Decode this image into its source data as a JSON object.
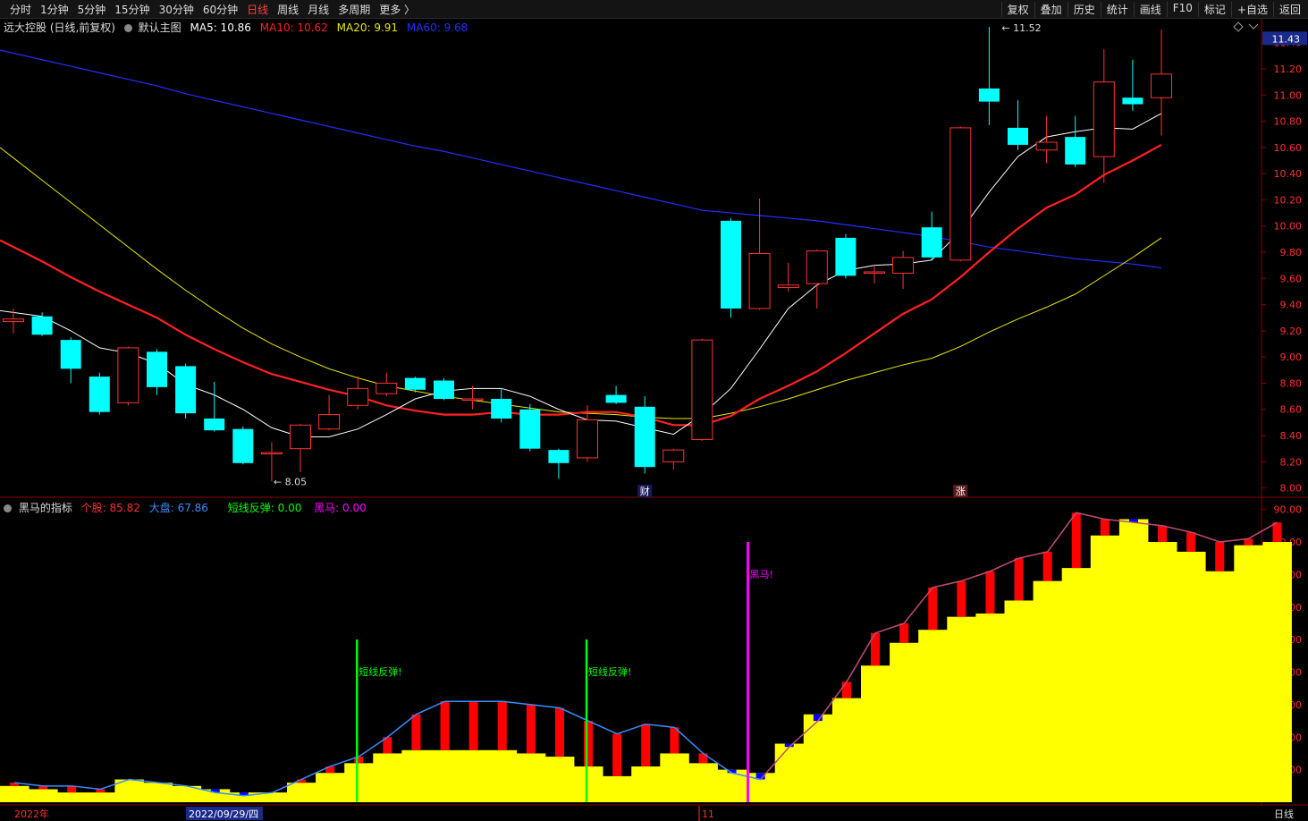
{
  "toolbar": {
    "periods": [
      "分时",
      "1分钟",
      "5分钟",
      "15分钟",
      "30分钟",
      "60分钟",
      "日线",
      "周线",
      "月线",
      "多周期",
      "更多 〉"
    ],
    "active_period": "日线",
    "tools": [
      "复权",
      "叠加",
      "历史",
      "统计",
      "画线",
      "F10",
      "标记",
      "+自选",
      "返回"
    ]
  },
  "main_header": {
    "stock": "远大控股 (日线,前复权)",
    "template": "默认主图",
    "ma5_label": "MA5: 10.86",
    "ma10_label": "MA10: 10.62",
    "ma20_label": "MA20: 9.91",
    "ma60_label": "MA60: 9.68"
  },
  "sub_header": {
    "indicator": "黑马的指标",
    "stock_label": "个股: 85.82",
    "market_label": "大盘: 67.86",
    "rebound_label": "短线反弹: 0.00",
    "horse_label": "黑马: 0.00"
  },
  "colors": {
    "up": "#ff3232",
    "down": "#00ffff",
    "ma5": "#ffffff",
    "ma10": "#ff2020",
    "ma20": "#e8e800",
    "ma60": "#2030ff",
    "vol_yellow": "#ffff00",
    "bar_red": "#ff0000",
    "bar_blue": "#0000ff",
    "market_line": "#3a8cff",
    "signal_green": "#00ff00",
    "signal_magenta": "#ff00ff"
  },
  "chart_data": [
    {
      "type": "candlestick",
      "title": "远大控股 (日线,前复权)",
      "y_ticks": [
        "11.40",
        "11.20",
        "11.00",
        "10.80",
        "10.60",
        "10.40",
        "10.20",
        "10.00",
        "9.80",
        "9.60",
        "9.40",
        "9.20",
        "9.00",
        "8.80",
        "8.60",
        "8.40",
        "8.20",
        "8.00"
      ],
      "current_price": "11.43",
      "ylim": [
        7.97,
        11.48
      ],
      "high_marker": "11.52",
      "low_marker": "8.05",
      "event_markers": [
        "财",
        "涨"
      ],
      "candles": [
        {
          "o": 9.27,
          "c": 9.29,
          "h": 9.37,
          "l": 9.18
        },
        {
          "o": 9.31,
          "c": 9.17,
          "h": 9.34,
          "l": 9.16
        },
        {
          "o": 9.13,
          "c": 8.91,
          "h": 9.15,
          "l": 8.8
        },
        {
          "o": 8.85,
          "c": 8.58,
          "h": 8.88,
          "l": 8.56
        },
        {
          "o": 8.65,
          "c": 9.07,
          "h": 9.08,
          "l": 8.63
        },
        {
          "o": 9.04,
          "c": 8.77,
          "h": 9.06,
          "l": 8.71
        },
        {
          "o": 8.93,
          "c": 8.57,
          "h": 8.95,
          "l": 8.53
        },
        {
          "o": 8.53,
          "c": 8.44,
          "h": 8.81,
          "l": 8.43
        },
        {
          "o": 8.45,
          "c": 8.19,
          "h": 8.47,
          "l": 8.18
        },
        {
          "o": 8.27,
          "c": 8.27,
          "h": 8.35,
          "l": 8.05
        },
        {
          "o": 8.3,
          "c": 8.48,
          "h": 8.49,
          "l": 8.12
        },
        {
          "o": 8.45,
          "c": 8.56,
          "h": 8.71,
          "l": 8.44
        },
        {
          "o": 8.63,
          "c": 8.76,
          "h": 8.85,
          "l": 8.6
        },
        {
          "o": 8.72,
          "c": 8.8,
          "h": 8.88,
          "l": 8.7
        },
        {
          "o": 8.84,
          "c": 8.75,
          "h": 8.85,
          "l": 8.73
        },
        {
          "o": 8.82,
          "c": 8.68,
          "h": 8.84,
          "l": 8.67
        },
        {
          "o": 8.68,
          "c": 8.68,
          "h": 8.78,
          "l": 8.6
        },
        {
          "o": 8.68,
          "c": 8.53,
          "h": 8.76,
          "l": 8.5
        },
        {
          "o": 8.6,
          "c": 8.3,
          "h": 8.64,
          "l": 8.28
        },
        {
          "o": 8.29,
          "c": 8.19,
          "h": 8.3,
          "l": 8.07
        },
        {
          "o": 8.23,
          "c": 8.52,
          "h": 8.63,
          "l": 8.2
        },
        {
          "o": 8.71,
          "c": 8.65,
          "h": 8.78,
          "l": 8.64
        },
        {
          "o": 8.62,
          "c": 8.16,
          "h": 8.7,
          "l": 8.11
        },
        {
          "o": 8.2,
          "c": 8.29,
          "h": 8.3,
          "l": 8.14
        },
        {
          "o": 8.37,
          "c": 9.13,
          "h": 9.14,
          "l": 8.36
        },
        {
          "o": 10.04,
          "c": 9.37,
          "h": 10.06,
          "l": 9.3
        },
        {
          "o": 9.37,
          "c": 9.79,
          "h": 10.21,
          "l": 9.36
        },
        {
          "o": 9.53,
          "c": 9.55,
          "h": 9.72,
          "l": 9.5
        },
        {
          "o": 9.56,
          "c": 9.81,
          "h": 9.82,
          "l": 9.37
        },
        {
          "o": 9.91,
          "c": 9.62,
          "h": 9.94,
          "l": 9.6
        },
        {
          "o": 9.64,
          "c": 9.65,
          "h": 9.7,
          "l": 9.56
        },
        {
          "o": 9.64,
          "c": 9.76,
          "h": 9.81,
          "l": 9.52
        },
        {
          "o": 9.99,
          "c": 9.76,
          "h": 10.11,
          "l": 9.74
        },
        {
          "o": 9.74,
          "c": 10.75,
          "h": 10.76,
          "l": 9.73
        },
        {
          "o": 11.05,
          "c": 10.95,
          "h": 11.52,
          "l": 10.77
        },
        {
          "o": 10.75,
          "c": 10.62,
          "h": 10.96,
          "l": 10.58
        },
        {
          "o": 10.58,
          "c": 10.64,
          "h": 10.84,
          "l": 10.48
        },
        {
          "o": 10.68,
          "c": 10.47,
          "h": 10.84,
          "l": 10.45
        },
        {
          "o": 10.53,
          "c": 11.1,
          "h": 11.35,
          "l": 10.33
        },
        {
          "o": 10.98,
          "c": 10.93,
          "h": 11.27,
          "l": 10.88
        },
        {
          "o": 10.98,
          "c": 11.16,
          "h": 11.5,
          "l": 10.69
        }
      ],
      "ma5": [
        9.34,
        9.31,
        9.2,
        9.07,
        9.03,
        8.95,
        8.79,
        8.71,
        8.6,
        8.46,
        8.39,
        8.39,
        8.45,
        8.56,
        8.68,
        8.74,
        8.76,
        8.76,
        8.7,
        8.6,
        8.52,
        8.51,
        8.46,
        8.41,
        8.56,
        8.76,
        9.06,
        9.37,
        9.55,
        9.66,
        9.7,
        9.71,
        9.74,
        9.96,
        10.26,
        10.53,
        10.68,
        10.72,
        10.75,
        10.74,
        10.86
      ],
      "ma10": [
        9.84,
        9.73,
        9.61,
        9.5,
        9.4,
        9.3,
        9.17,
        9.06,
        8.96,
        8.87,
        8.81,
        8.75,
        8.7,
        8.63,
        8.59,
        8.56,
        8.56,
        8.58,
        8.56,
        8.56,
        8.58,
        8.58,
        8.54,
        8.48,
        8.48,
        8.55,
        8.68,
        8.78,
        8.89,
        9.03,
        9.18,
        9.33,
        9.44,
        9.61,
        9.8,
        9.98,
        10.14,
        10.24,
        10.39,
        10.5,
        10.62
      ],
      "ma20": [
        10.52,
        10.35,
        10.18,
        10.01,
        9.84,
        9.67,
        9.51,
        9.36,
        9.22,
        9.1,
        9.0,
        8.91,
        8.84,
        8.78,
        8.74,
        8.7,
        8.67,
        8.64,
        8.61,
        8.58,
        8.57,
        8.56,
        8.54,
        8.53,
        8.53,
        8.57,
        8.62,
        8.68,
        8.75,
        8.82,
        8.88,
        8.94,
        8.99,
        9.08,
        9.19,
        9.29,
        9.38,
        9.48,
        9.62,
        9.76,
        9.91
      ],
      "ma60": [
        11.32,
        11.27,
        11.22,
        11.17,
        11.12,
        11.07,
        11.01,
        10.96,
        10.91,
        10.86,
        10.81,
        10.76,
        10.71,
        10.66,
        10.61,
        10.57,
        10.52,
        10.47,
        10.42,
        10.37,
        10.32,
        10.27,
        10.22,
        10.17,
        10.12,
        10.1,
        10.08,
        10.06,
        10.04,
        10.01,
        9.98,
        9.95,
        9.92,
        9.88,
        9.84,
        9.81,
        9.78,
        9.75,
        9.73,
        9.71,
        9.68
      ]
    },
    {
      "type": "bar",
      "title": "黑马的指标",
      "y_ticks": [
        "90.00",
        "80.00",
        "70.00",
        "60.00",
        "50.00",
        "40.00",
        "30.00",
        "20.00",
        "10.00"
      ],
      "ylim": [
        0,
        91
      ],
      "x_labels": [
        "2022年",
        "2022/09/29/四",
        "11"
      ],
      "series": [
        {
          "name": "个股",
          "values": [
            6,
            5,
            5,
            4,
            7,
            6,
            5,
            3,
            2,
            3,
            7,
            11,
            14,
            20,
            27,
            31,
            31,
            31,
            30,
            29,
            25,
            21,
            24,
            23,
            15,
            9,
            7,
            17,
            25,
            37,
            52,
            55,
            66,
            68,
            71,
            75,
            77,
            89,
            87,
            86,
            85,
            83,
            80,
            81,
            86
          ]
        },
        {
          "name": "大盘",
          "values": [
            5,
            4,
            3,
            3,
            7,
            6,
            5,
            4,
            3,
            3,
            6,
            9,
            12,
            15,
            16,
            16,
            16,
            16,
            15,
            14,
            11,
            8,
            11,
            15,
            12,
            10,
            9,
            18,
            27,
            32,
            42,
            49,
            53,
            57,
            58,
            62,
            68,
            72,
            82,
            87,
            80,
            77,
            71,
            79,
            80,
            40,
            68
          ]
        },
        {
          "name": "短线反弹",
          "values": [
            0,
            0,
            0,
            0,
            0,
            0,
            0,
            0,
            0,
            0,
            0,
            0,
            50,
            0,
            0,
            0,
            0,
            0,
            0,
            0,
            50,
            0,
            0,
            0,
            0,
            0,
            0,
            0,
            0,
            0,
            0,
            0,
            0,
            0,
            0,
            0,
            0,
            0,
            0,
            0,
            0,
            0,
            0,
            0,
            0,
            0,
            0
          ]
        },
        {
          "name": "黑马",
          "values": [
            0,
            0,
            0,
            0,
            0,
            0,
            0,
            0,
            0,
            0,
            0,
            0,
            0,
            0,
            0,
            0,
            0,
            0,
            0,
            0,
            0,
            0,
            0,
            0,
            0,
            80,
            0,
            0,
            0,
            0,
            0,
            0,
            0,
            0,
            0,
            0,
            0,
            0,
            0,
            0,
            0,
            0,
            0,
            0,
            0,
            0,
            0
          ]
        }
      ],
      "annotations": [
        "短线反弹!",
        "短线反弹!",
        "黑马!"
      ],
      "bottom_right_label": "日线"
    }
  ]
}
